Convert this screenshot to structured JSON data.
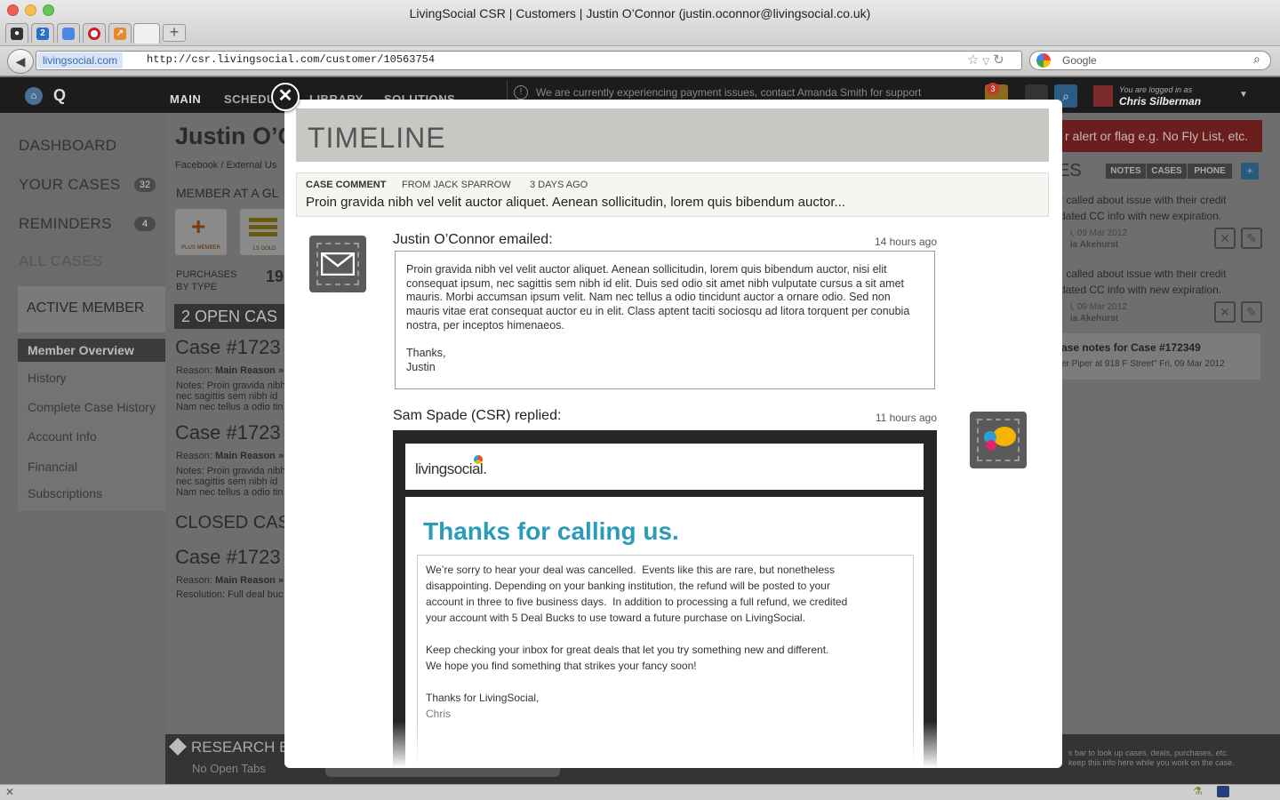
{
  "window": {
    "title": "LivingSocial CSR | Customers | Justin O’Connor (justin.oconnor@livingsocial.co.uk)"
  },
  "tabs": [
    {
      "icon": "github-icon",
      "label": ""
    },
    {
      "icon": "calendar-icon",
      "label": "2"
    },
    {
      "icon": "docs-icon",
      "label": ""
    },
    {
      "icon": "record-icon",
      "label": ""
    },
    {
      "icon": "analytics-icon",
      "label": ""
    }
  ],
  "browser": {
    "url_domain": "livingsocial.com",
    "url": "http://csr.livingsocial.com/customer/10563754",
    "search_placeholder": "Google",
    "new_tab_label": "+"
  },
  "app_header": {
    "nav": [
      "MAIN",
      "SCHEDULE",
      "LIBRARY",
      "SOLUTIONS"
    ],
    "alert": "We are currently experiencing payment issues, contact Amanda Smith for support",
    "notification_count": "3",
    "logged_in_label": "You are logged in as",
    "user_name": "Chris Silberman"
  },
  "sidebar": {
    "items": [
      {
        "label": "DASHBOARD",
        "count": ""
      },
      {
        "label": "YOUR CASES",
        "count": "32"
      },
      {
        "label": "REMINDERS",
        "count": "4"
      },
      {
        "label": "ALL CASES",
        "count": ""
      }
    ],
    "section": "ACTIVE MEMBER",
    "sub_items": [
      "Member Overview",
      "History",
      "Complete Case History",
      "Account Info",
      "Financial",
      "Subscriptions"
    ]
  },
  "background": {
    "member_name": "Justin O’C",
    "member_source": "Facebook / External Us",
    "glance": "MEMBER AT A GL",
    "badge_plus": "PLUS MEMBER",
    "badge_gold": "LS GOLD",
    "purchases": "PURCHASES",
    "by_type": "BY TYPE",
    "purchases_count": "19",
    "open_cases": "2 OPEN CAS",
    "case_num": "Case #1723",
    "reason_label": "Reason:",
    "reason_value": "Main Reason »",
    "notes_1": "Notes: Proin gravida nibh",
    "notes_2": "nec sagittis sem nibh id",
    "notes_3": "Nam nec tellus a odio tin",
    "closed_cases": "CLOSED CAS",
    "resolution": "Resolution: Full deal buc",
    "right_alert": "r alert or flag e.g. No Fly List, etc.",
    "right_tabs": [
      "NOTES",
      "CASES",
      "PHONE"
    ],
    "right_note_1a": "r called about issue with their credit",
    "right_note_1b": "dated CC info with new expiration.",
    "right_date": "i, 09 Mar 2012",
    "right_author": "ia Akehurst",
    "right_case_notes": "ase notes for Case #172349",
    "right_case_sub": "er Piper at 918 F Street\"   Fri, 09 Mar 2012",
    "research_title": "RESEARCH B",
    "research_sub": "No Open Tabs",
    "research_help_1": "s bar to look up cases, deals, purchases, etc.",
    "research_help_2": "keep this info here while you work on the case."
  },
  "timeline": {
    "title": "TIMELINE",
    "case_comment": {
      "label": "CASE COMMENT",
      "from": "FROM JACK SPARROW",
      "when": "3 DAYS AGO",
      "text": "Proin gravida nibh vel velit auctor aliquet. Aenean sollicitudin, lorem quis bibendum auctor..."
    },
    "email": {
      "who": "Justin O’Connor emailed:",
      "time": "14 hours ago",
      "body": "Proin gravida nibh vel velit auctor aliquet. Aenean sollicitudin, lorem quis bibendum auctor, nisi elit consequat ipsum, nec sagittis sem nibh id elit. Duis sed odio sit amet nibh vulputate cursus a sit amet mauris. Morbi accumsan ipsum velit. Nam nec tellus a odio tincidunt auctor a ornare odio. Sed non mauris vitae erat consequat auctor eu in elit. Class aptent taciti sociosqu ad litora torquent per conubia nostra, per inceptos himenaeos.\n\nThanks,\nJustin"
    },
    "reply": {
      "who": "Sam Spade (CSR) replied:",
      "time": "11 hours ago",
      "logo": "livingsocial.",
      "heading": "Thanks for calling us.",
      "body": "We’re sorry to hear your deal was cancelled.  Events like this are rare, but nonetheless\ndisappointing. Depending on your banking institution, the refund will be posted to your\naccount in three to five business days.  In addition to processing a full refund, we credited\nyour account with 5 Deal Bucks to use toward a future purchase on LivingSocial.\n\nKeep checking your inbox for great deals that let you try something new and different.\nWe hope you find something that strikes your fancy soon!\n\nThanks for LivingSocial,",
      "signature": "Chris"
    }
  }
}
